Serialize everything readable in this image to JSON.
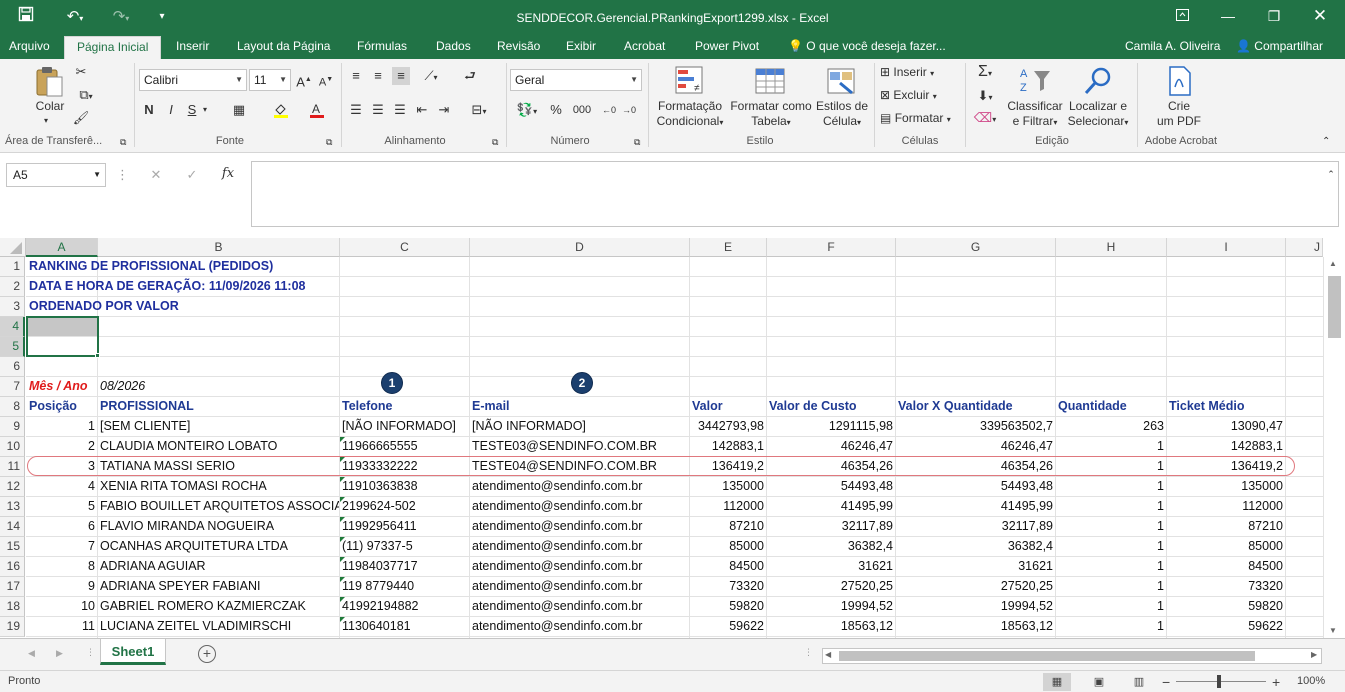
{
  "app": {
    "window_title": "SENDDECOR.Gerencial.PRankingExport1299.xlsx - Excel",
    "user": "Camila A. Oliveira",
    "share_label": "Compartilhar",
    "tell_me_placeholder": "O que você deseja fazer..."
  },
  "tabs": [
    "Arquivo",
    "Página Inicial",
    "Inserir",
    "Layout da Página",
    "Fórmulas",
    "Dados",
    "Revisão",
    "Exibir",
    "Acrobat",
    "Power Pivot"
  ],
  "ribbon": {
    "clipboard": {
      "paste": "Colar",
      "group": "Área de Transferê..."
    },
    "font": {
      "name": "Calibri",
      "size": "11",
      "group": "Fonte",
      "bold": "N",
      "italic": "I",
      "underline": "S"
    },
    "alignment": {
      "group": "Alinhamento"
    },
    "number": {
      "format": "Geral",
      "group": "Número",
      "percent": "%",
      "thousands": "000"
    },
    "styles": {
      "cond_format_1": "Formatação",
      "cond_format_2": "Condicional",
      "table_1": "Formatar como",
      "table_2": "Tabela",
      "cell_1": "Estilos de",
      "cell_2": "Célula",
      "group": "Estilo"
    },
    "cells": {
      "insert": "Inserir",
      "delete": "Excluir",
      "format": "Formatar",
      "group": "Células"
    },
    "editing": {
      "sort_1": "Classificar",
      "sort_2": "e Filtrar",
      "find_1": "Localizar e",
      "find_2": "Selecionar",
      "group": "Edição"
    },
    "acrobat": {
      "pdf_1": "Crie",
      "pdf_2": "um PDF",
      "group": "Adobe Acrobat"
    }
  },
  "formula_bar": {
    "name_box": "A5",
    "fx": "fx",
    "content": ""
  },
  "columns": [
    "A",
    "B",
    "C",
    "D",
    "E",
    "F",
    "G",
    "H",
    "I",
    "J"
  ],
  "rows": [
    "1",
    "2",
    "3",
    "4",
    "5",
    "6",
    "7",
    "8",
    "9",
    "10",
    "11",
    "12",
    "13",
    "14",
    "15",
    "16",
    "17",
    "18",
    "19"
  ],
  "sheet": {
    "title1": "RANKING DE PROFISSIONAL (PEDIDOS)",
    "title2": "DATA E HORA DE GERAÇÃO: 11/09/2026 11:08",
    "title3": "ORDENADO POR VALOR",
    "mes_label": "Mês / Ano",
    "mes_value": "08/2026",
    "headers": [
      "Posição",
      "PROFISSIONAL",
      "Telefone",
      "E-mail",
      "Valor",
      "Valor de Custo",
      "Valor X Quantidade",
      "Quantidade",
      "Ticket Médio"
    ],
    "data": [
      [
        "1",
        "[SEM CLIENTE]",
        "[NÃO INFORMADO]",
        "[NÃO INFORMADO]",
        "3442793,98",
        "1291115,98",
        "339563502,7",
        "263",
        "13090,47"
      ],
      [
        "2",
        "CLAUDIA MONTEIRO LOBATO",
        "11966665555",
        "TESTE03@SENDINFO.COM.BR",
        "142883,1",
        "46246,47",
        "46246,47",
        "1",
        "142883,1"
      ],
      [
        "3",
        "TATIANA MASSI SERIO",
        "11933332222",
        "TESTE04@SENDINFO.COM.BR",
        "136419,2",
        "46354,26",
        "46354,26",
        "1",
        "136419,2"
      ],
      [
        "4",
        "XENIA RITA TOMASI ROCHA",
        "11910363838",
        "atendimento@sendinfo.com.br",
        "135000",
        "54493,48",
        "54493,48",
        "1",
        "135000"
      ],
      [
        "5",
        "FABIO BOUILLET ARQUITETOS ASSOCIAD",
        "2199624-502",
        "atendimento@sendinfo.com.br",
        "112000",
        "41495,99",
        "41495,99",
        "1",
        "112000"
      ],
      [
        "6",
        "FLAVIO MIRANDA NOGUEIRA",
        "11992956411",
        "atendimento@sendinfo.com.br",
        "87210",
        "32117,89",
        "32117,89",
        "1",
        "87210"
      ],
      [
        "7",
        " OCANHAS ARQUITETURA LTDA",
        "(11) 97337-5",
        "atendimento@sendinfo.com.br",
        "85000",
        "36382,4",
        "36382,4",
        "1",
        "85000"
      ],
      [
        "8",
        "ADRIANA AGUIAR",
        "11984037717",
        "atendimento@sendinfo.com.br",
        "84500",
        "31621",
        "31621",
        "1",
        "84500"
      ],
      [
        "9",
        "ADRIANA SPEYER FABIANI",
        "119 8779440",
        "atendimento@sendinfo.com.br",
        "73320",
        "27520,25",
        "27520,25",
        "1",
        "73320"
      ],
      [
        "10",
        "GABRIEL ROMERO KAZMIERCZAK",
        "41992194882",
        "atendimento@sendinfo.com.br",
        "59820",
        "19994,52",
        "19994,52",
        "1",
        "59820"
      ],
      [
        "11",
        "LUCIANA ZEITEL VLADIMIRSCHI",
        "1130640181",
        "atendimento@sendinfo.com.br",
        "59622",
        "18563,12",
        "18563,12",
        "1",
        "59622"
      ]
    ],
    "badges": [
      "1",
      "2"
    ]
  },
  "sheet_tabs": {
    "active": "Sheet1"
  },
  "status": {
    "ready": "Pronto",
    "zoom": "100%"
  }
}
